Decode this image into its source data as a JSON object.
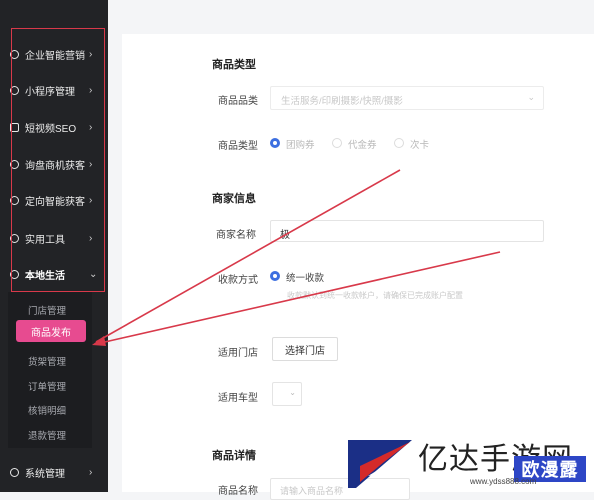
{
  "sidebar": {
    "items": [
      {
        "label": "企业智能营销",
        "icon": "grid-icon"
      },
      {
        "label": "小程序管理",
        "icon": "miniapp-icon"
      },
      {
        "label": "短视频SEO",
        "icon": "video-icon"
      },
      {
        "label": "询盘商机获客",
        "icon": "inquiry-icon"
      },
      {
        "label": "定向智能获客",
        "icon": "target-icon"
      },
      {
        "label": "实用工具",
        "icon": "tools-icon"
      },
      {
        "label": "本地生活",
        "icon": "local-life-icon"
      },
      {
        "label": "系统管理",
        "icon": "settings-icon"
      }
    ],
    "sub_items": [
      "门店管理",
      "商品发布",
      "货架管理",
      "订单管理",
      "核销明细",
      "退款管理"
    ],
    "active_sub": "商品发布"
  },
  "form": {
    "section_product_type": "商品类型",
    "label_category": "商品品类",
    "category_value": "生活服务/印刷摄影/快照/摄影",
    "label_type": "商品类型",
    "type_options": [
      "团购券",
      "代金券",
      "次卡"
    ],
    "section_merchant": "商家信息",
    "label_merchant_name": "商家名称",
    "merchant_name_value": "极",
    "label_payment": "收款方式",
    "payment_option": "统一收款",
    "payment_hint": "收款默认到统一收款帐户，请确保已完成账户配置",
    "label_stores": "适用门店",
    "select_store_button": "选择门店",
    "label_vehicle": "适用车型",
    "section_details": "商品详情",
    "label_product_name": "商品名称",
    "product_name_placeholder": "请输入商品名称"
  },
  "watermark": {
    "text": "亿达手游网",
    "badge": "欧漫露",
    "url": "www.ydss888.com"
  },
  "colors": {
    "sidebar_bg": "#222326",
    "active_pink": "#e74b90",
    "radio_blue": "#3d6fe0",
    "annotation_red": "#d8394a"
  }
}
